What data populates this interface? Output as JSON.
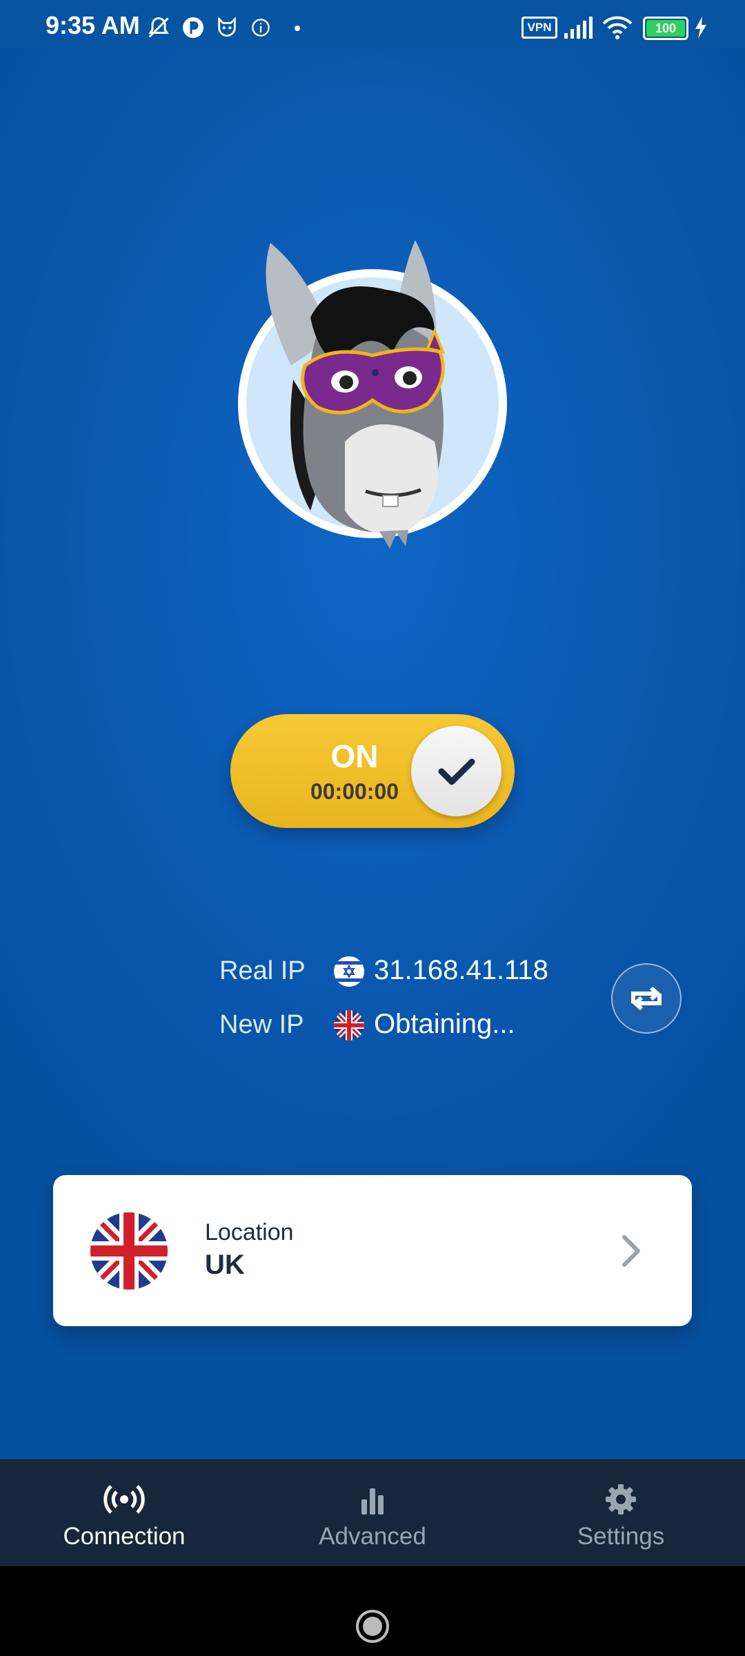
{
  "status_bar": {
    "time": "9:35 AM",
    "vpn_badge": "VPN",
    "battery_level": "100",
    "icons": [
      "mute-icon",
      "app-icon",
      "fox-icon",
      "info-icon",
      "dot-icon",
      "vpn-icon",
      "signal-icon",
      "wifi-icon",
      "battery-icon",
      "charging-icon"
    ]
  },
  "toggle": {
    "state_label": "ON",
    "timer": "00:00:00"
  },
  "ip_info": {
    "real_ip_label": "Real IP",
    "real_ip_value": "31.168.41.118",
    "new_ip_label": "New IP",
    "new_ip_value": "Obtaining..."
  },
  "location": {
    "label": "Location",
    "value": "UK"
  },
  "bottom_nav": {
    "items": [
      {
        "label": "Connection",
        "icon": "broadcast-icon",
        "active": true
      },
      {
        "label": "Advanced",
        "icon": "bar-chart-icon",
        "active": false
      },
      {
        "label": "Settings",
        "icon": "gear-icon",
        "active": false
      }
    ]
  },
  "colors": {
    "background": "#0b5bb4",
    "toggle": "#f2bf2b",
    "nav_background": "#17263a",
    "text_dark": "#1f2a44"
  }
}
